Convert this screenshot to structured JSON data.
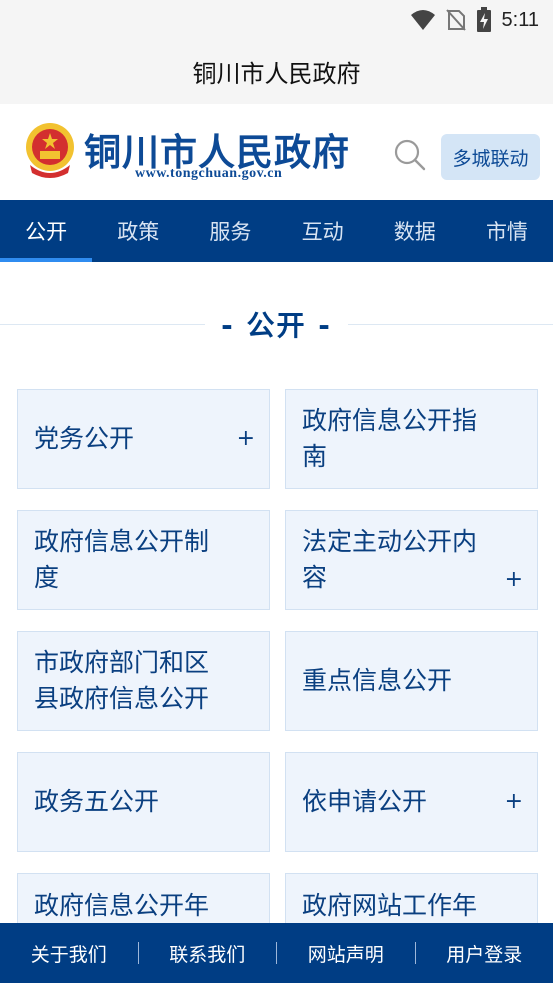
{
  "status_bar": {
    "time": "5:11",
    "icons": [
      "wifi-icon",
      "no-sim-icon",
      "battery-charging-icon"
    ]
  },
  "title_bar": {
    "title": "铜川市人民政府"
  },
  "header": {
    "logo_text": "铜川市人民政府",
    "logo_url": "www.tongchuan.gov.cn",
    "search_icon": "search-icon",
    "multi_city_label": "多城联动"
  },
  "nav": {
    "items": [
      {
        "label": "公开",
        "active": true
      },
      {
        "label": "政策",
        "active": false
      },
      {
        "label": "服务",
        "active": false
      },
      {
        "label": "互动",
        "active": false
      },
      {
        "label": "数据",
        "active": false
      },
      {
        "label": "市情",
        "active": false
      }
    ]
  },
  "section": {
    "title": "- 公开 -"
  },
  "tiles": [
    {
      "label": "党务公开",
      "expandable": true,
      "plus": "+"
    },
    {
      "label": "政府信息公开指南",
      "expandable": false,
      "plus": ""
    },
    {
      "label": "政府信息公开制度",
      "expandable": false,
      "plus": ""
    },
    {
      "label": "法定主动公开内容",
      "expandable": true,
      "plus": "+"
    },
    {
      "label": "市政府部门和区县政府信息公开",
      "expandable": false,
      "plus": ""
    },
    {
      "label": "重点信息公开",
      "expandable": false,
      "plus": ""
    },
    {
      "label": "政务五公开",
      "expandable": false,
      "plus": ""
    },
    {
      "label": "依申请公开",
      "expandable": true,
      "plus": "+"
    },
    {
      "label": "政府信息公开年",
      "expandable": false,
      "plus": ""
    },
    {
      "label": "政府网站工作年",
      "expandable": false,
      "plus": ""
    }
  ],
  "footer": {
    "links": [
      "关于我们",
      "联系我们",
      "网站声明",
      "用户登录"
    ]
  },
  "colors": {
    "primary": "#003d84",
    "logo_blue": "#0d4a96",
    "tile_bg": "#eef4fc",
    "tile_border": "#d2e1f2",
    "active_underline": "#2f8cf0",
    "emblem_red": "#d32f2f",
    "emblem_gold": "#f2c230"
  }
}
